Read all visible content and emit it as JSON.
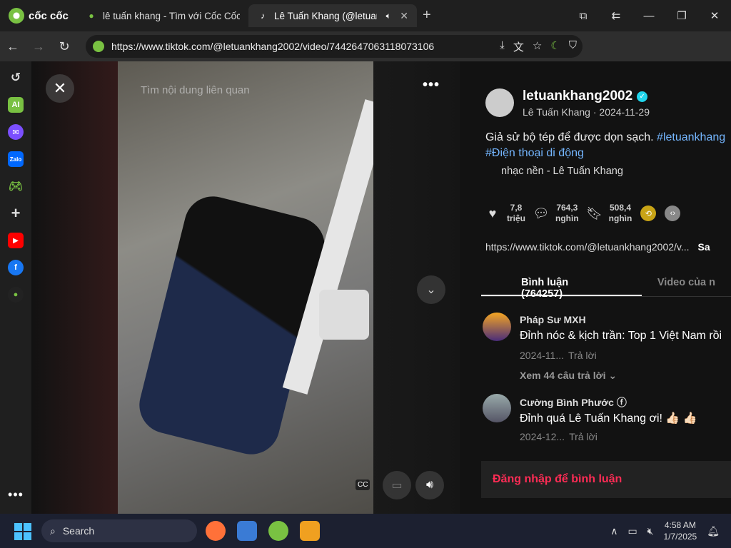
{
  "browser": {
    "brand": "cốc cốc",
    "tabs": [
      {
        "title": "lê tuấn khang - Tìm với Cốc Cốc"
      },
      {
        "title": "Lê Tuấn Khang (@letuank"
      }
    ],
    "url": "https://www.tiktok.com/@letuankhang2002/video/7442647063118073106"
  },
  "player": {
    "hint": "Tìm nội dung liên quan"
  },
  "post": {
    "username": "letuankhang2002",
    "subline": "Lê Tuấn Khang · 2024-11-29",
    "caption_text": "Giả sử bộ tép để được dọn sạch. ",
    "caption_tag1": "#letuankhang",
    "caption_tag2": "#Điện thoại di động",
    "music": "nhạc nền - Lê Tuấn Khang",
    "likes": [
      "7,8",
      "triệu"
    ],
    "comments_count": [
      "764,3",
      "nghìn"
    ],
    "saves": [
      "508,4",
      "nghìn"
    ],
    "link": "https://www.tiktok.com/@letuankhang2002/v...",
    "copy_label": "Sa",
    "tab_comments": "Bình luận (764257)",
    "tab_videos": "Video của n",
    "login_prompt": "Đăng nhập để bình luận"
  },
  "comments": [
    {
      "name": "Pháp Sư MXH",
      "text": "Đỉnh nóc & kịch trần: Top 1 Việt Nam rồi",
      "date": "2024-11...",
      "reply": "Trả lời",
      "more_replies": "Xem 44 câu trả lời ⌄"
    },
    {
      "name": "Cường Bình Phước",
      "text": "Đỉnh quá Lê Tuấn Khang ơi! 👍🏻 👍🏻",
      "date": "2024-12...",
      "reply": "Trả lời"
    }
  ],
  "taskbar": {
    "search": "Search",
    "time": "4:58 AM",
    "date": "1/7/2025"
  },
  "colors": {
    "accent": "#fe2c55",
    "hashtag": "#74b6ff",
    "coccoc": "#79c142"
  }
}
